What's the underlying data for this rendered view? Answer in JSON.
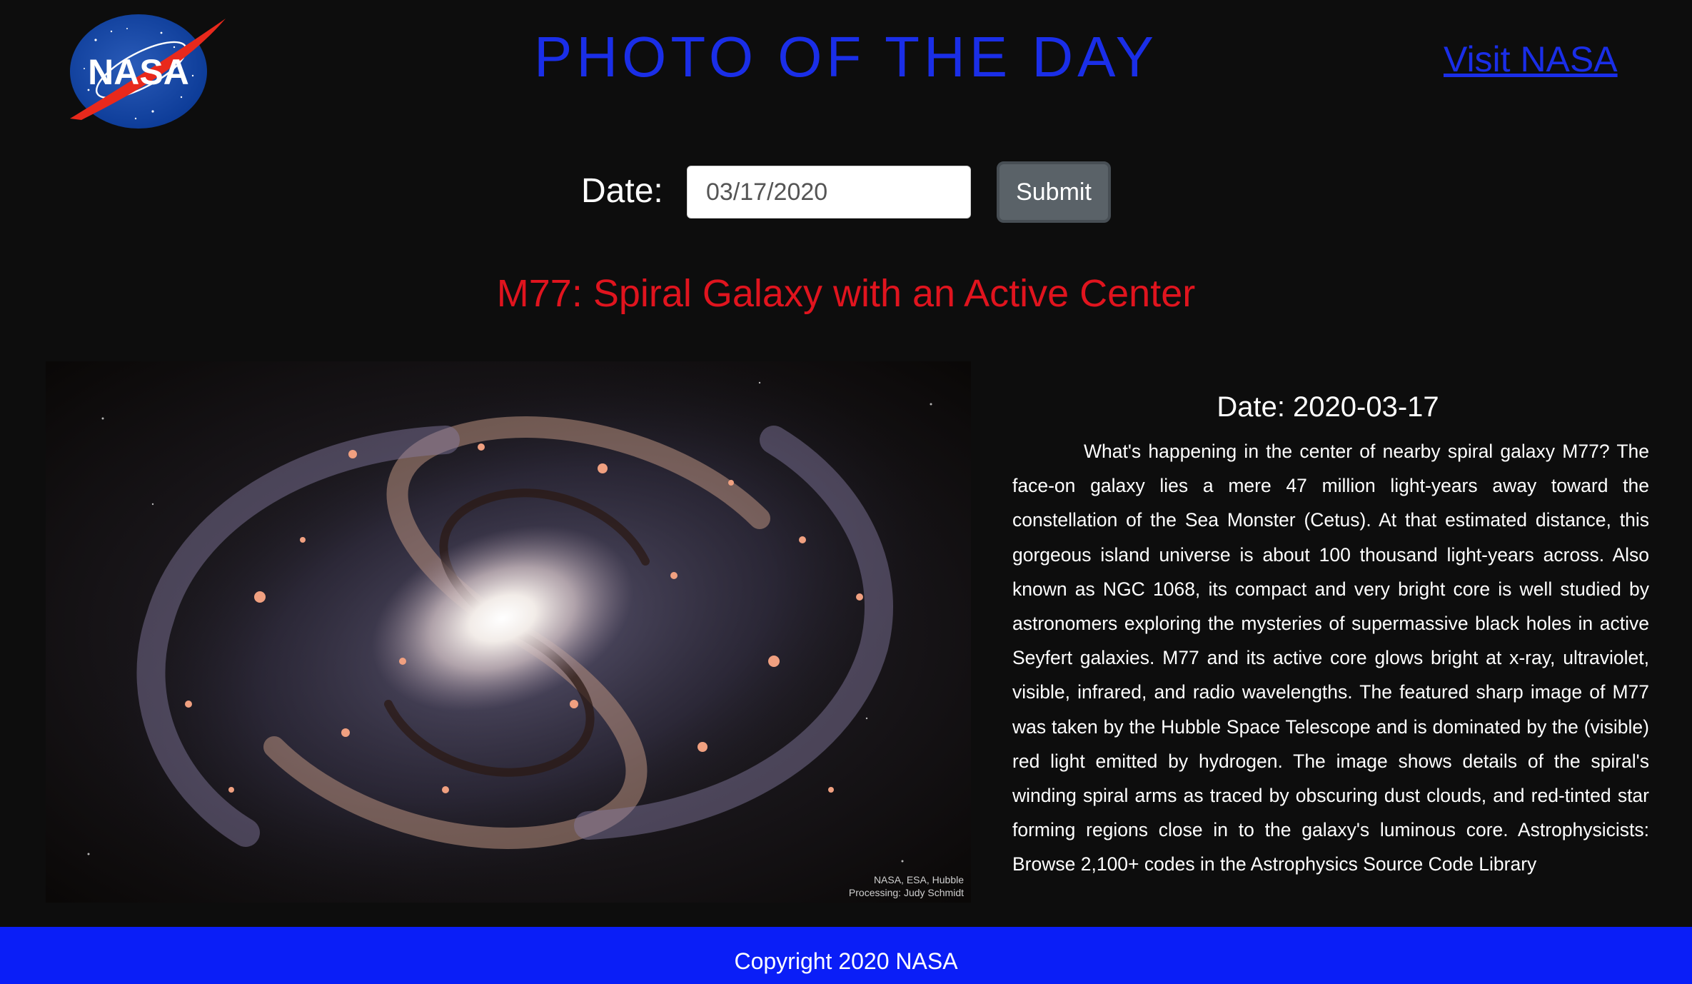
{
  "header": {
    "logo_text": "NASA",
    "title": "PHOTO OF THE DAY",
    "visit_link": "Visit NASA"
  },
  "form": {
    "date_label": "Date:",
    "date_value": "03/17/2020",
    "submit_label": "Submit"
  },
  "photo": {
    "title": "M77: Spiral Galaxy with an Active Center",
    "credit_line1": "NASA, ESA, Hubble",
    "credit_line2": "Processing: Judy Schmidt",
    "date_text": "Date: 2020-03-17",
    "explanation": "What's happening in the center of nearby spiral galaxy M77? The face-on galaxy lies a mere 47 million light-years away toward the constellation of the Sea Monster (Cetus). At that estimated distance, this gorgeous island universe is about 100 thousand light-years across. Also known as NGC 1068, its compact and very bright core is well studied by astronomers exploring the mysteries of supermassive black holes in active Seyfert galaxies. M77 and its active core glows bright at x-ray, ultraviolet, visible, infrared, and radio wavelengths. The featured sharp image of M77 was taken by the Hubble Space Telescope and is dominated by the (visible) red light emitted by hydrogen. The image shows details of the spiral's winding spiral arms as traced by obscuring dust clouds, and red-tinted star forming regions close in to the galaxy's luminous core. Astrophysicists: Browse 2,100+ codes in the Astrophysics Source Code Library"
  },
  "footer": {
    "text": "Copyright 2020 NASA"
  },
  "colors": {
    "background": "#0d0d0d",
    "title_blue": "#1a2ee8",
    "photo_title_red": "#e0141e",
    "footer_blue": "#0a1ef7",
    "submit_gray": "#5a6268"
  },
  "icons": {
    "logo": "nasa-meatball-logo"
  }
}
